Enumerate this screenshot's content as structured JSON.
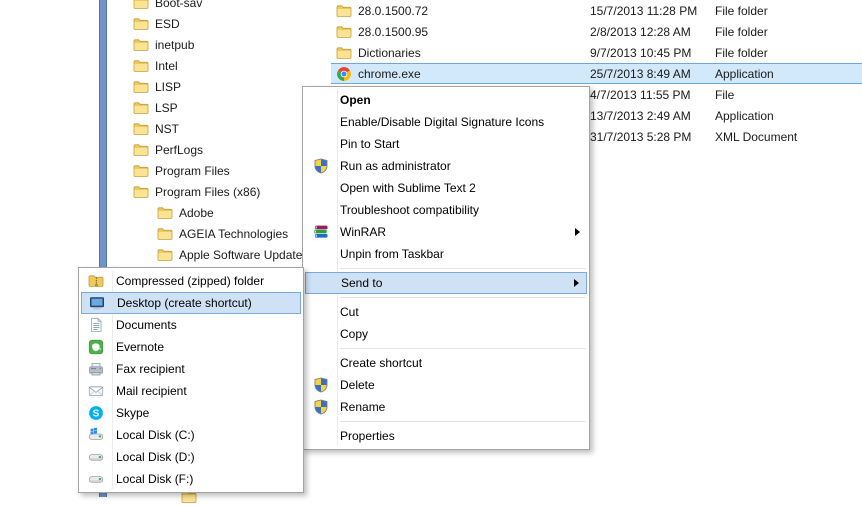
{
  "colors": {
    "selection_fill": "#d2e8fb",
    "selection_border": "#6da8dc",
    "menu_highlight_fill": "#cfe2f5",
    "menu_highlight_border": "#7aabd8",
    "window_edge_blue": "#6f94cc"
  },
  "folder_tree": {
    "items": [
      {
        "label": "Boot-sav",
        "level": 0,
        "icon": "folder"
      },
      {
        "label": "ESD",
        "level": 0,
        "icon": "folder"
      },
      {
        "label": "inetpub",
        "level": 0,
        "icon": "folder"
      },
      {
        "label": "Intel",
        "level": 0,
        "icon": "folder"
      },
      {
        "label": "LISP",
        "level": 0,
        "icon": "folder"
      },
      {
        "label": "LSP",
        "level": 0,
        "icon": "folder"
      },
      {
        "label": "NST",
        "level": 0,
        "icon": "folder"
      },
      {
        "label": "PerfLogs",
        "level": 0,
        "icon": "folder"
      },
      {
        "label": "Program Files",
        "level": 0,
        "icon": "folder"
      },
      {
        "label": "Program Files (x86)",
        "level": 0,
        "icon": "folder"
      },
      {
        "label": "Adobe",
        "level": 1,
        "icon": "folder"
      },
      {
        "label": "AGEIA Technologies",
        "level": 1,
        "icon": "folder"
      },
      {
        "label": "Apple Software Update",
        "level": 1,
        "icon": "folder"
      }
    ]
  },
  "file_list": {
    "rows": [
      {
        "name": "28.0.1500.72",
        "icon": "folder",
        "date": "15/7/2013 11:28 PM",
        "type": "File folder",
        "selected": false
      },
      {
        "name": "28.0.1500.95",
        "icon": "folder",
        "date": "2/8/2013 12:28 AM",
        "type": "File folder",
        "selected": false
      },
      {
        "name": "Dictionaries",
        "icon": "folder",
        "date": "9/7/2013 10:45 PM",
        "type": "File folder",
        "selected": false
      },
      {
        "name": "chrome.exe",
        "icon": "chrome",
        "date": "25/7/2013 8:49 AM",
        "type": "Application",
        "selected": true
      },
      {
        "name": "",
        "icon": null,
        "date": "4/7/2013 11:55 PM",
        "type": "File",
        "selected": false
      },
      {
        "name": "",
        "icon": null,
        "date": "13/7/2013 2:49 AM",
        "type": "Application",
        "selected": false
      },
      {
        "name": "",
        "icon": null,
        "date": "31/7/2013 5:28 PM",
        "type": "XML Document",
        "selected": false
      }
    ]
  },
  "context_menu": {
    "items": [
      {
        "label": "Open",
        "bold": true
      },
      {
        "label": "Enable/Disable Digital Signature Icons"
      },
      {
        "label": "Pin to Start"
      },
      {
        "label": "Run as administrator",
        "icon": "uac-shield"
      },
      {
        "label": "Open with Sublime Text 2"
      },
      {
        "label": "Troubleshoot compatibility"
      },
      {
        "label": "WinRAR",
        "icon": "winrar",
        "submenu": true
      },
      {
        "label": "Unpin from Taskbar"
      },
      {
        "separator": true
      },
      {
        "label": "Send to",
        "submenu": true,
        "highlighted": true
      },
      {
        "separator": true
      },
      {
        "label": "Cut"
      },
      {
        "label": "Copy"
      },
      {
        "separator": true
      },
      {
        "label": "Create shortcut"
      },
      {
        "label": "Delete",
        "icon": "uac-shield"
      },
      {
        "label": "Rename",
        "icon": "uac-shield"
      },
      {
        "separator": true
      },
      {
        "label": "Properties"
      }
    ]
  },
  "send_to_menu": {
    "items": [
      {
        "label": "Compressed (zipped) folder",
        "icon": "zip-folder"
      },
      {
        "label": "Desktop (create shortcut)",
        "icon": "desktop",
        "highlighted": true
      },
      {
        "label": "Documents",
        "icon": "documents"
      },
      {
        "label": "Evernote",
        "icon": "evernote"
      },
      {
        "label": "Fax recipient",
        "icon": "fax"
      },
      {
        "label": "Mail recipient",
        "icon": "mail"
      },
      {
        "label": "Skype",
        "icon": "skype"
      },
      {
        "label": "Local Disk (C:)",
        "icon": "disk-c"
      },
      {
        "label": "Local Disk (D:)",
        "icon": "disk"
      },
      {
        "label": "Local Disk (F:)",
        "icon": "disk"
      }
    ]
  }
}
